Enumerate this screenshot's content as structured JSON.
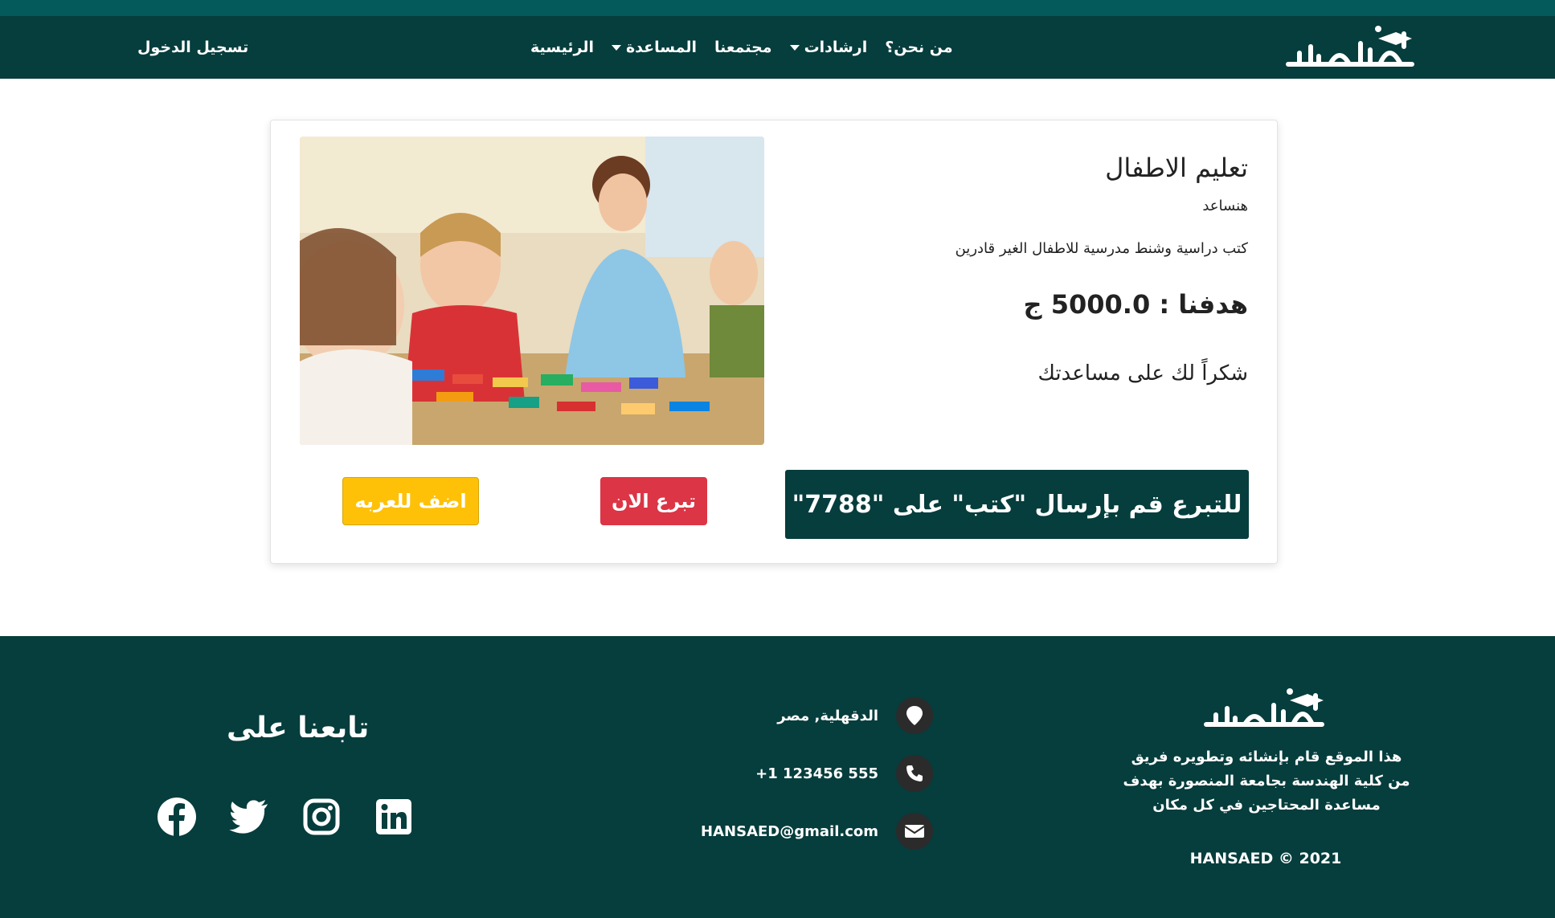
{
  "nav": {
    "brand": "هنساعد",
    "items": [
      {
        "label": "الرئيسية",
        "dropdown": false
      },
      {
        "label": "المساعدة",
        "dropdown": true
      },
      {
        "label": "مجتمعنا",
        "dropdown": false
      },
      {
        "label": "ارشادات",
        "dropdown": true
      },
      {
        "label": "من نحن؟",
        "dropdown": false
      }
    ],
    "login_label": "تسجيل الدخول"
  },
  "card": {
    "title": "تعليم الاطفال",
    "org": "هنساعد",
    "description": "كتب دراسية وشنط مدرسية للاطفال الغير قادرين",
    "goal": "هدفنا : 5000.0 ج",
    "thanks": "شكراً لك على مساعدتك",
    "sms_text": "للتبرع قم بإرسال \"كتب\" على \"7788\"",
    "donate_label": "تبرع الان",
    "add_to_cart_label": "اضف للعربه"
  },
  "footer": {
    "brand": "هنساعد",
    "about": "هذا الموقع قام بإنشائه وتطويره فريق من كلية الهندسة بجامعة المنصورة بهدف مساعدة المحتاجين في كل مكان",
    "copyright": "HANSAED © 2021",
    "address": "الدقهلية, مصر",
    "phone": "+1 123456 555",
    "email": "HANSAED@gmail.com",
    "follow_title": "تابعنا على",
    "socials": [
      "facebook-icon",
      "twitter-icon",
      "instagram-icon",
      "linkedin-icon"
    ]
  },
  "colors": {
    "primary": "#063d3d",
    "topstrip": "#045a5a",
    "danger": "#dc3545",
    "warning": "#ffc107"
  }
}
